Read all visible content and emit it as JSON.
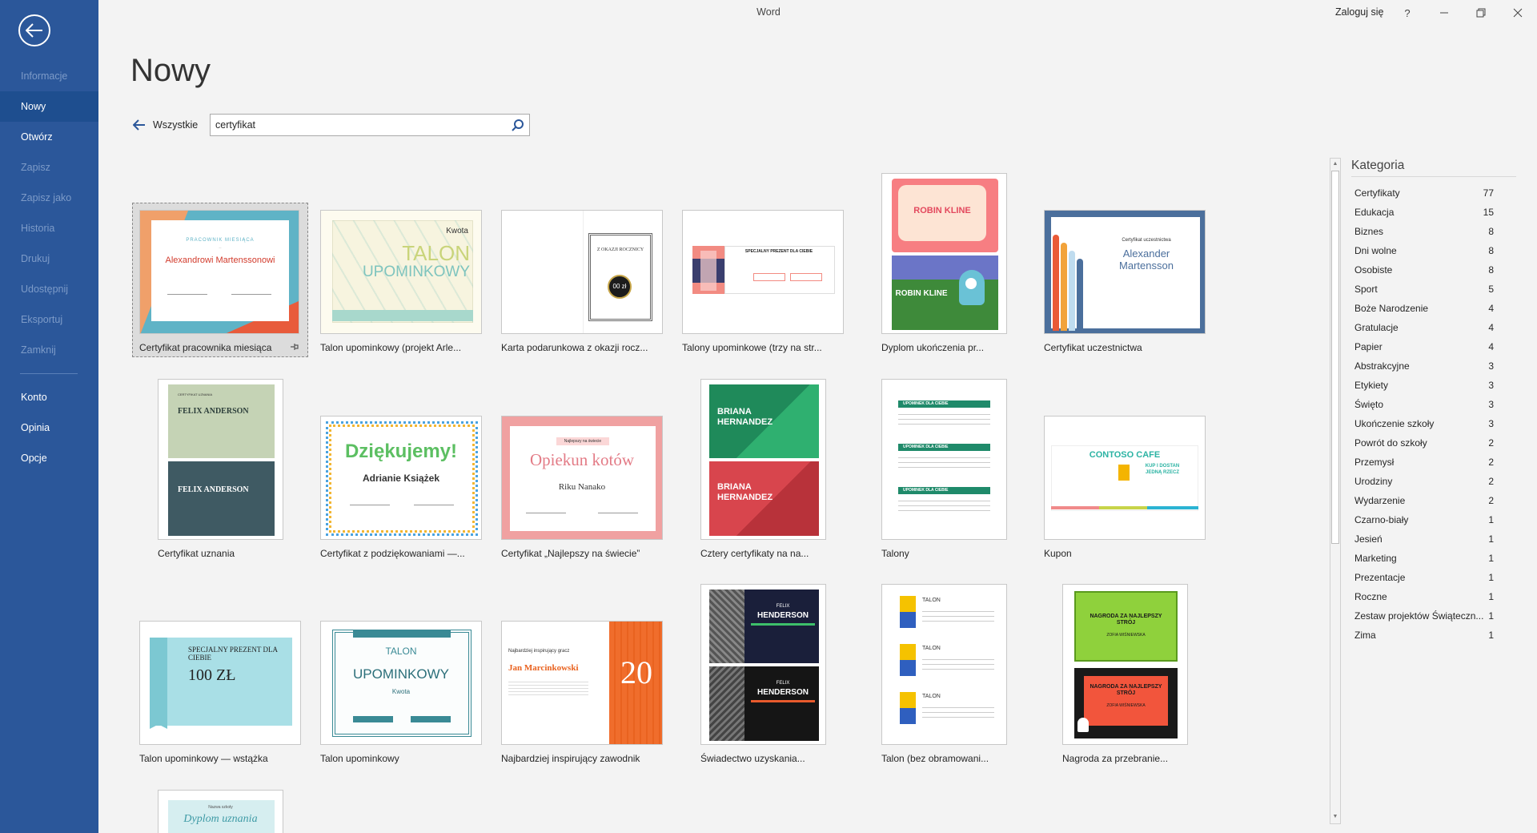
{
  "app": {
    "title": "Word",
    "signin": "Zaloguj się",
    "help": "?",
    "colors": {
      "sidebar": "#2b579a",
      "accent": "#2b579a",
      "background": "#f3f3f3"
    }
  },
  "sidebar": {
    "items": [
      {
        "label": "Informacje",
        "enabled": false
      },
      {
        "label": "Nowy",
        "enabled": true,
        "active": true
      },
      {
        "label": "Otwórz",
        "enabled": true
      },
      {
        "label": "Zapisz",
        "enabled": false
      },
      {
        "label": "Zapisz jako",
        "enabled": false
      },
      {
        "label": "Historia",
        "enabled": false
      },
      {
        "label": "Drukuj",
        "enabled": false
      },
      {
        "label": "Udostępnij",
        "enabled": false
      },
      {
        "label": "Eksportuj",
        "enabled": false
      },
      {
        "label": "Zamknij",
        "enabled": false
      }
    ],
    "bottom_items": [
      {
        "label": "Konto"
      },
      {
        "label": "Opinia"
      },
      {
        "label": "Opcje"
      }
    ]
  },
  "page": {
    "title": "Nowy",
    "all_link": "Wszystkie",
    "search_value": "certyfikat"
  },
  "templates": [
    {
      "label": "Certyfikat pracownika miesiąca",
      "thumb": {
        "heading": "PRACOWNIK MIESIĄCA",
        "name": "Alexandrowi Martenssonowi"
      }
    },
    {
      "label": "Talon upominkowy (projekt Arle...",
      "thumb": {
        "line1": "TALON",
        "line2": "UPOMINKOWY",
        "tag": "Kwota"
      }
    },
    {
      "label": "Karta podarunkowa z okazji rocz...",
      "thumb": {
        "title": "Z OKAZJI ROCZNICY",
        "amount": "00 zł"
      }
    },
    {
      "label": "Talony upominkowe (trzy na str...",
      "thumb": {
        "heading": "SPECJALNY PREZENT DLA CIEBIE"
      }
    },
    {
      "label": "Dyplom ukończenia pr...",
      "thumb": {
        "name": "ROBIN KLINE"
      }
    },
    {
      "label": "Certyfikat uczestnictwa",
      "thumb": {
        "heading": "Certyfikat uczestnictwa",
        "name": "Alexander Martensson"
      }
    },
    {
      "label": "Certyfikat uznania",
      "thumb": {
        "heading": "CERTYFIKAT UZNANIA",
        "name": "FELIX ANDERSON"
      }
    },
    {
      "label": "Certyfikat z podziękowaniami —...",
      "thumb": {
        "title": "Dziękujemy!",
        "name": "Adrianie Książek"
      }
    },
    {
      "label": "Certyfikat „Najlepszy na świecie”",
      "thumb": {
        "tag": "Najlepszy na świecie",
        "title": "Opiekun kotów",
        "name": "Riku Nanako"
      }
    },
    {
      "label": "Cztery certyfikaty na na...",
      "thumb": {
        "name1": "BRIANA",
        "name2": "HERNANDEZ"
      }
    },
    {
      "label": "Talony",
      "thumb": {
        "heading": "UPOMINEK DLA CIEBIE"
      }
    },
    {
      "label": "Kupon",
      "thumb": {
        "title": "CONTOSO CAFE",
        "offer": "KUP I DOSTAN JEDNĄ RZECZ"
      }
    },
    {
      "label": "Talon upominkowy — wstążka",
      "thumb": {
        "heading": "SPECJALNY PREZENT DLA CIEBIE",
        "amount": "100 ZŁ"
      }
    },
    {
      "label": "Talon upominkowy",
      "thumb": {
        "line1": "TALON",
        "line2": "UPOMINKOWY",
        "tag": "Kwota"
      }
    },
    {
      "label": "Najbardziej inspirujący zawodnik",
      "thumb": {
        "heading": "Najbardziej inspirujący gracz",
        "name": "Jan Marcinkowski",
        "number": "20"
      }
    },
    {
      "label": "Świadectwo uzyskania...",
      "thumb": {
        "first": "FELIX",
        "last": "HENDERSON"
      }
    },
    {
      "label": "Talon (bez obramowani...",
      "thumb": {
        "heading": "TALON"
      }
    },
    {
      "label": "Nagroda za przebranie...",
      "thumb": {
        "heading": "NAGRODA ZA NAJLEPSZY STRÓJ",
        "name": "ZOFIA WIŚNIEWSKA"
      }
    },
    {
      "label": "",
      "thumb": {
        "heading": "Nazwa szkoły",
        "title": "Dyplom uznania"
      }
    }
  ],
  "categories": {
    "title": "Kategoria",
    "items": [
      {
        "name": "Certyfikaty",
        "count": "77"
      },
      {
        "name": "Edukacja",
        "count": "15"
      },
      {
        "name": "Biznes",
        "count": "8"
      },
      {
        "name": "Dni wolne",
        "count": "8"
      },
      {
        "name": "Osobiste",
        "count": "8"
      },
      {
        "name": "Sport",
        "count": "5"
      },
      {
        "name": "Boże Narodzenie",
        "count": "4"
      },
      {
        "name": "Gratulacje",
        "count": "4"
      },
      {
        "name": "Papier",
        "count": "4"
      },
      {
        "name": "Abstrakcyjne",
        "count": "3"
      },
      {
        "name": "Etykiety",
        "count": "3"
      },
      {
        "name": "Święto",
        "count": "3"
      },
      {
        "name": "Ukończenie szkoły",
        "count": "3"
      },
      {
        "name": "Powrót do szkoły",
        "count": "2"
      },
      {
        "name": "Przemysł",
        "count": "2"
      },
      {
        "name": "Urodziny",
        "count": "2"
      },
      {
        "name": "Wydarzenie",
        "count": "2"
      },
      {
        "name": "Czarno-biały",
        "count": "1"
      },
      {
        "name": "Jesień",
        "count": "1"
      },
      {
        "name": "Marketing",
        "count": "1"
      },
      {
        "name": "Prezentacje",
        "count": "1"
      },
      {
        "name": "Roczne",
        "count": "1"
      },
      {
        "name": "Zestaw projektów Świąteczn...",
        "count": "1"
      },
      {
        "name": "Zima",
        "count": "1"
      }
    ]
  }
}
